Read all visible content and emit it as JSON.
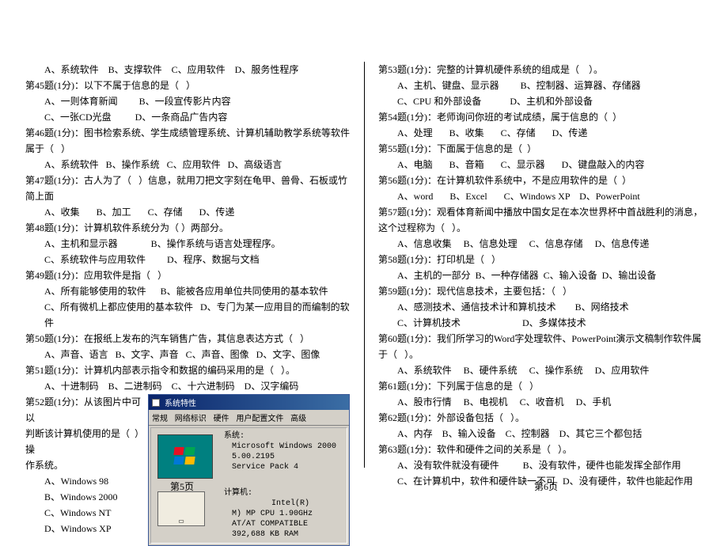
{
  "left": {
    "l1": "A、系统软件    B、支撑软件    C、应用软件    D、服务性程序",
    "q45": "第45题(1分)：以下不属于信息的是（   ）",
    "q45a": "A、一则体育新闻         B、一段宣传影片内容",
    "q45b": "C、一张CD光盘          D、一条商品广告内容",
    "q46": "第46题(1分)：图书检索系统、学生成绩管理系统、计算机辅助教学系统等软件属于（   ）",
    "q46a": "A、系统软件   B、操作系统   C、应用软件   D、高级语言",
    "q47": "第47题(1分)：古人为了（   ）信息，就用刀把文字刻在龟甲、兽骨、石板或竹简上面",
    "q47a": "A、收集       B、加工       C、存储       D、传递",
    "q48": "第48题(1分)：计算机软件系统分为（ ）两部分。",
    "q48a": "A、主机和显示器              B、操作系统与语言处理程序。",
    "q48b": "C、系统软件与应用软件         D、程序、数据与文档",
    "q49": "第49题(1分)：应用软件是指（   ）",
    "q49a": "A、所有能够使用的软件      B、能被各应用单位共同使用的基本软件",
    "q49b": "C、所有微机上都应使用的基本软件   D、专门为某一应用目的而编制的软件",
    "q50": "第50题(1分)：在报纸上发布的汽车销售广告，其信息表达方式（   ）",
    "q50a": "A、声音、语言   B、文字、声音   C、声音、图像   D、文字、图像",
    "q51": "第51题(1分)：计算机内部表示指令和数据的编码采用的是（   ）。",
    "q51a": "A、十进制码    B、二进制码    C、十六进制码    D、汉字编码",
    "q52a": "第52题(1分)：从该图片中可以",
    "q52b": "判断该计算机使用的是（  ）操",
    "q52c": "作系统。",
    "q52optA": "A、Windows 98",
    "q52optB": "B、Windows 2000",
    "q52optC": "C、Windows NT",
    "q52optD": "D、Windows XP"
  },
  "right": {
    "q53": "第53题(1分)：完整的计算机硬件系统的组成是（    ）。",
    "q53a": "A、主机、键盘、显示器         B、控制器、运算器、存储器",
    "q53b": "C、CPU 和外部设备            D、主机和外部设备",
    "q54": "第54题(1分)：老师询问你班的考试成绩，属于信息的（  ）",
    "q54a": "A、处理       B、收集       C、存储       D、传递",
    "q55": "第55题(1分)：下面属于信息的是（  ）",
    "q55a": "A、电脑       B、音箱       C、显示器       D、键盘敲入的内容",
    "q56": "第56题(1分)：在计算机软件系统中，不是应用软件的是（  ）",
    "q56a": "A、word       B、Excel       C、Windows XP    D、PowerPoint",
    "q57": "第57题(1分)：观看体育新闻中播放中国女足在本次世界杯中首战胜利的消息，这个过程称为（   ）。",
    "q57a": "A、信息收集     B、信息处理     C、信息存储     D、信息传递",
    "q58": "第58题(1分)：打印机是（   ）",
    "q58a": "A、主机的一部分  B、一种存储器  C、输入设备  D、输出设备",
    "q59": "第59题(1分)：现代信息技术，主要包括：（   ）",
    "q59a": "A、感测技术、通信技术计和算机技术        B、网络技术",
    "q59b": "C、计算机技术                          D、多媒体技术",
    "q60": "第60题(1分)：我们所学习的Word字处理软件、PowerPoint演示文稿制作软件属于（   ）。",
    "q60a": "A、系统软件     B、硬件系统     C、操作系统     D、应用软件",
    "q61": "第61题(1分)：下列属于信息的是（   ）",
    "q61a": "A、股市行情     B、电视机     C、收音机     D、手机",
    "q62": "第62题(1分)：外部设备包括（   ）。",
    "q62a": "A、内存    B、输入设备    C、控制器    D、其它三个都包括",
    "q63": "第63题(1分)：软件和硬件之间的关系是（   ）。",
    "q63a": "A、没有软件就没有硬件          B、没有软件，硬件也能发挥全部作用",
    "q63b": "C、在计算机中，软件和硬件缺一不可   D、没有硬件，软件也能起作用"
  },
  "sysprops": {
    "title": "系统特性",
    "tabs": {
      "t1": "常规",
      "t2": "网络标识",
      "t3": "硬件",
      "t4": "用户配置文件",
      "t5": "高级"
    },
    "syslabel": "系统:",
    "os": "Microsoft Windows 2000",
    "ver": "5.00.2195",
    "sp": "Service Pack 4",
    "complabel": "计算机:",
    "chip": "Intel(R)",
    "cpu": "M) MP CPU 1.90GHz",
    "at": "AT/AT COMPATIBLE",
    "ram": "392,688 KB RAM"
  },
  "footer": {
    "p5": "第5页",
    "p6": "第6页"
  }
}
